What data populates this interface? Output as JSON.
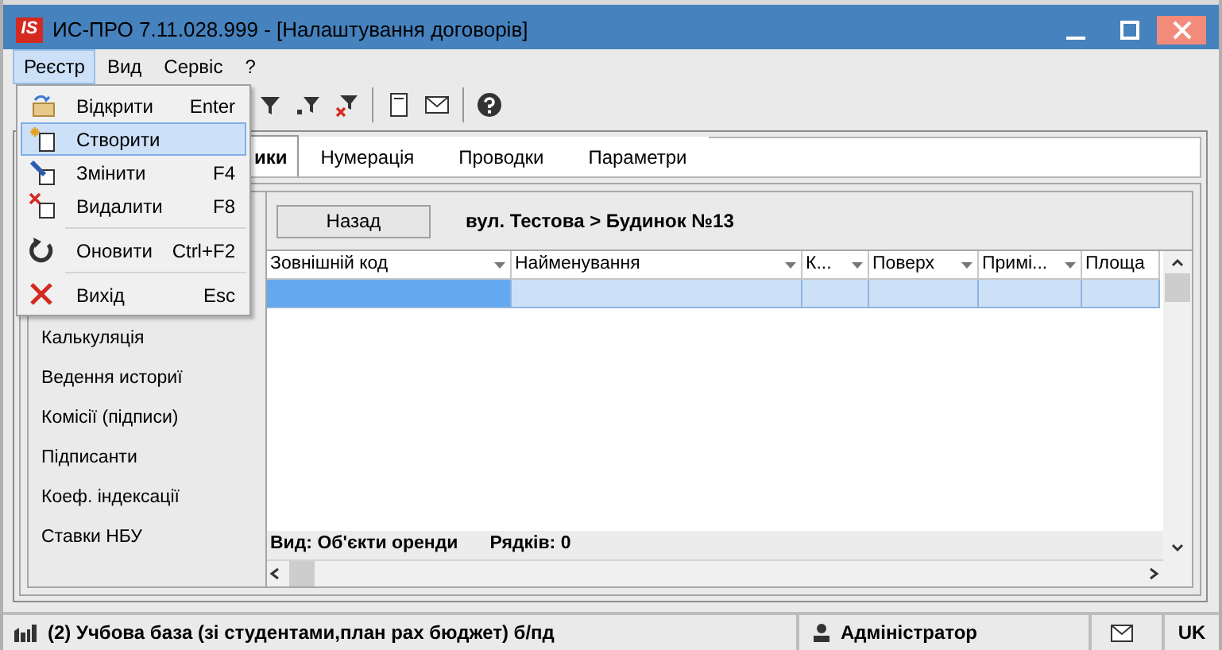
{
  "window": {
    "logo": "IS",
    "title": "ИС-ПРО 7.11.028.999 - [Налаштування договорів]"
  },
  "menu_bar": [
    {
      "label": "Реєстр",
      "selected": true
    },
    {
      "label": "Вид",
      "selected": false
    },
    {
      "label": "Сервіс",
      "selected": false
    },
    {
      "label": "?",
      "selected": false
    }
  ],
  "dropdown": [
    {
      "kind": "item",
      "label": "Відкрити",
      "shortcut": "Enter",
      "selected": false
    },
    {
      "kind": "item",
      "label": "Створити",
      "selected": true
    },
    {
      "kind": "item",
      "label": "Змінити",
      "shortcut": "F4",
      "selected": false
    },
    {
      "kind": "item",
      "label": "Видалити",
      "shortcut": "F8",
      "selected": false
    },
    {
      "kind": "separator"
    },
    {
      "kind": "item",
      "label": "Оновити",
      "shortcut": "Ctrl+F2",
      "selected": false
    },
    {
      "kind": "separator"
    },
    {
      "kind": "item",
      "label": "Вихід",
      "shortcut": "Esc",
      "selected": false
    }
  ],
  "tabs": [
    {
      "label": "ики",
      "selected": true
    },
    {
      "label": "Нумерація",
      "selected": false
    },
    {
      "label": "Проводки",
      "selected": false
    },
    {
      "label": "Параметри",
      "selected": false
    }
  ],
  "sidebar": {
    "items": [
      "Калькуляція",
      "Ведення историї",
      "Комісії (підписи)",
      "Підписанти",
      "Коеф. індексації",
      "Ставки НБУ"
    ]
  },
  "back_button": "Назад",
  "breadcrumb": "вул. Тестова > Будинок №13",
  "table": {
    "columns": [
      {
        "label": "Зовнішній код",
        "filter": true
      },
      {
        "label": "Найменування",
        "filter": true
      },
      {
        "label": "К...",
        "filter": true
      },
      {
        "label": "Поверх",
        "filter": true
      },
      {
        "label": "Примі...",
        "filter": true
      },
      {
        "label": "Площа",
        "filter": false
      }
    ],
    "rows": [
      {
        "selected": true,
        "cells": [
          {
            "focused": true
          },
          {
            "focused": false
          },
          {
            "focused": false
          },
          {
            "focused": false
          },
          {
            "focused": false
          },
          {
            "focused": false
          }
        ]
      }
    ]
  },
  "footer": {
    "view": "Вид: Об'єкти оренди",
    "row_count": "Рядків: 0"
  },
  "status_bar": {
    "database": "(2) Учбова база (зі студентами,план рах бюджет) б/пд",
    "user": "Адміністратор",
    "language": "UK"
  }
}
